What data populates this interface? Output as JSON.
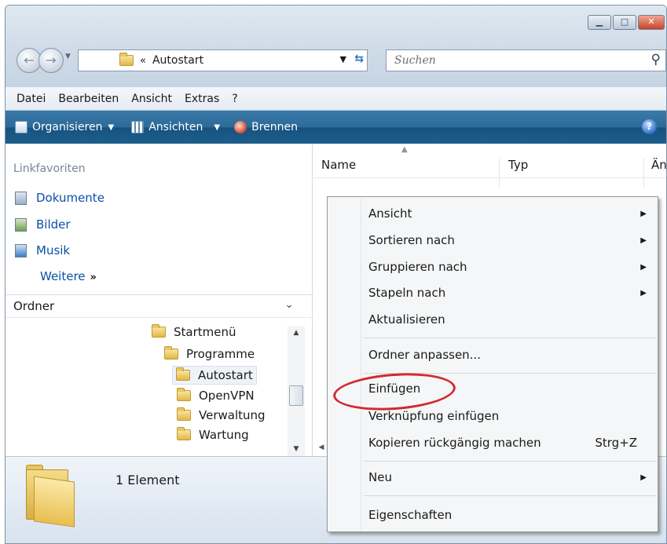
{
  "address": {
    "separator": "«",
    "current_folder": "Autostart"
  },
  "search": {
    "placeholder": "Suchen"
  },
  "menubar": {
    "items": [
      "Datei",
      "Bearbeiten",
      "Ansicht",
      "Extras",
      "?"
    ]
  },
  "toolbar": {
    "organize": "Organisieren",
    "views": "Ansichten",
    "burn": "Brennen"
  },
  "navpane": {
    "links_title": "Linkfavoriten",
    "favorites": [
      "Dokumente",
      "Bilder",
      "Musik"
    ],
    "more": "Weitere",
    "more_arrows": "»",
    "folders_title": "Ordner",
    "tree": [
      "Startmenü",
      "Programme",
      "Autostart",
      "OpenVPN",
      "Verwaltung",
      "Wartung"
    ]
  },
  "filelist": {
    "columns": [
      "Name",
      "Typ",
      "Än"
    ]
  },
  "details": {
    "count": "1 Element"
  },
  "context_menu": {
    "items": [
      {
        "label": "Ansicht",
        "submenu": true
      },
      {
        "label": "Sortieren nach",
        "submenu": true
      },
      {
        "label": "Gruppieren nach",
        "submenu": true
      },
      {
        "label": "Stapeln nach",
        "submenu": true
      },
      {
        "label": "Aktualisieren"
      },
      {
        "label": "Ordner anpassen..."
      },
      {
        "label": "Einfügen"
      },
      {
        "label": "Verknüpfung einfügen"
      },
      {
        "label": "Kopieren rückgängig machen",
        "shortcut": "Strg+Z"
      },
      {
        "label": "Neu",
        "submenu": true
      },
      {
        "label": "Eigenschaften"
      }
    ]
  },
  "icons": {
    "back": "back-arrow-icon",
    "forward": "forward-arrow-icon",
    "refresh": "refresh-icon",
    "search": "magnifier-icon",
    "help": "help-icon",
    "folder": "folder-icon"
  },
  "colors": {
    "toolbar": "#1d5e8c",
    "link": "#0d4fa6",
    "annotation": "#d22a31"
  }
}
